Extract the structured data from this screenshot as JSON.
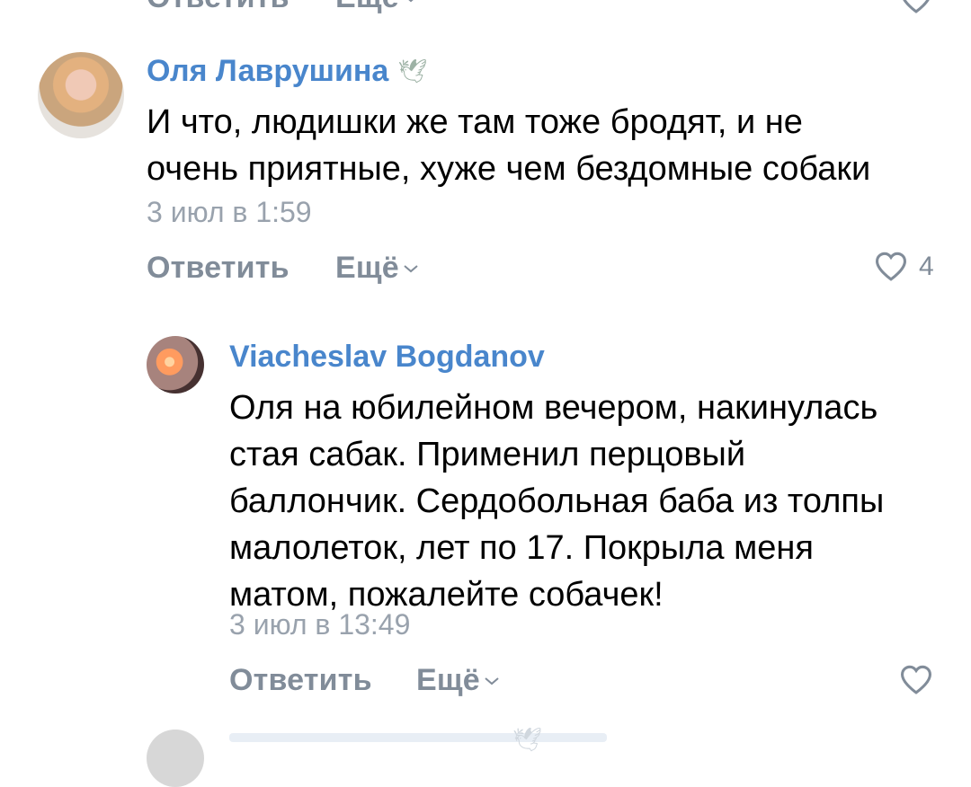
{
  "prev_comment": {
    "reply_label": "Ответить",
    "more_label": "Ещё"
  },
  "comment1": {
    "author": "Оля Лаврушина",
    "badge_icon": "dove-icon",
    "text_line1": "И что, людишки же там тоже бродят, и не",
    "text_line2": "очень приятные, хуже чем бездомные собаки",
    "time": "3 июл в 1:59",
    "reply_label": "Ответить",
    "more_label": "Ещё",
    "likes": "4"
  },
  "comment2": {
    "author": "Viacheslav Bogdanov",
    "text_line1": "Оля на юбилейном вечером, накинулась",
    "text_line2": "стая сабак. Применил перцовый",
    "text_line3": "баллончик. Сердобольная баба из толпы",
    "text_line4": "малолеток, лет по 17. Покрыла меня",
    "text_line5": "матом, пожалейте собачек!",
    "time": "3 июл в 13:49",
    "reply_label": "Ответить",
    "more_label": "Ещё"
  },
  "colors": {
    "author": "#4986cc",
    "secondary": "#818c99",
    "time": "#99a2ad"
  }
}
